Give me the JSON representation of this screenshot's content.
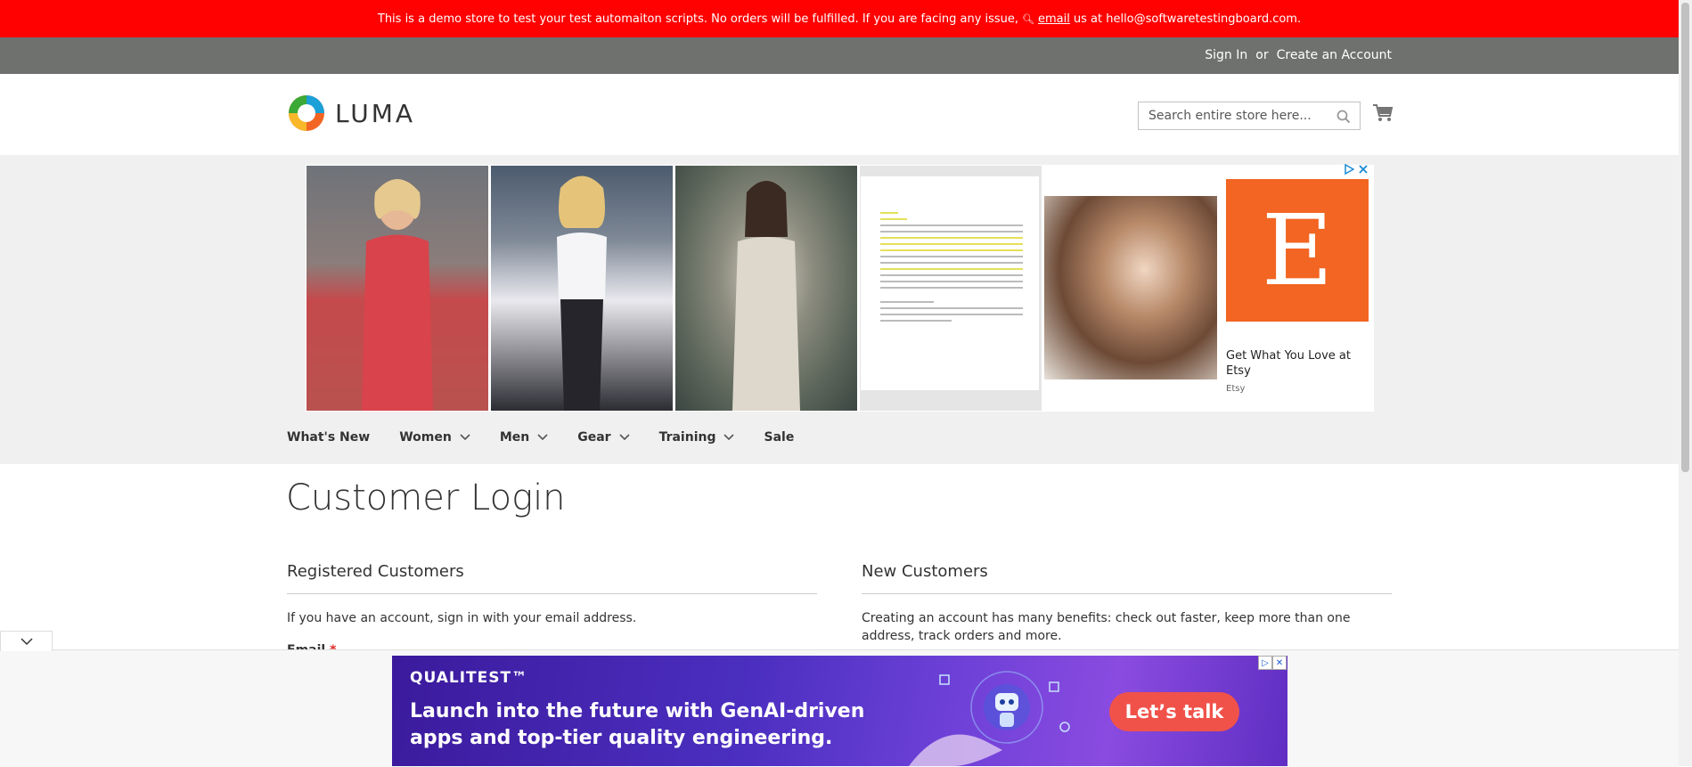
{
  "demo_notice": {
    "text_before": "This is a demo store to test your test automaiton scripts. No orders will be fulfilled. If you are facing any issue,",
    "email_link": "email",
    "text_after": "us at hello@softwaretestingboard.com."
  },
  "header_links": {
    "sign_in": "Sign In",
    "or": "or",
    "create_account": "Create an Account"
  },
  "logo": {
    "text": "LUMA"
  },
  "search": {
    "placeholder": "Search entire store here..."
  },
  "ad_top": {
    "headline": "Get What You Love at Etsy",
    "brand": "Etsy",
    "logo_letter": "E"
  },
  "nav": {
    "items": [
      {
        "label": "What's New"
      },
      {
        "label": "Women"
      },
      {
        "label": "Men"
      },
      {
        "label": "Gear"
      },
      {
        "label": "Training"
      },
      {
        "label": "Sale"
      }
    ]
  },
  "main": {
    "title": "Customer Login",
    "registered": {
      "title": "Registered Customers",
      "text": "If you have an account, sign in with your email address.",
      "email_label": "Email",
      "required_mark": "*"
    },
    "new_customers": {
      "title": "New Customers",
      "text": "Creating an account has many benefits: check out faster, keep more than one address, track orders and more."
    }
  },
  "bottom_ad": {
    "brand": "QUALITEST™",
    "headline": "Launch into the future with GenAI-driven apps and top-tier quality engineering.",
    "cta": "Let’s talk"
  },
  "colors": {
    "demo_bar": "#ff0101",
    "panel_header": "#6e716e",
    "logo_orange": "#f26522",
    "ad_cta": "#f0524a"
  }
}
